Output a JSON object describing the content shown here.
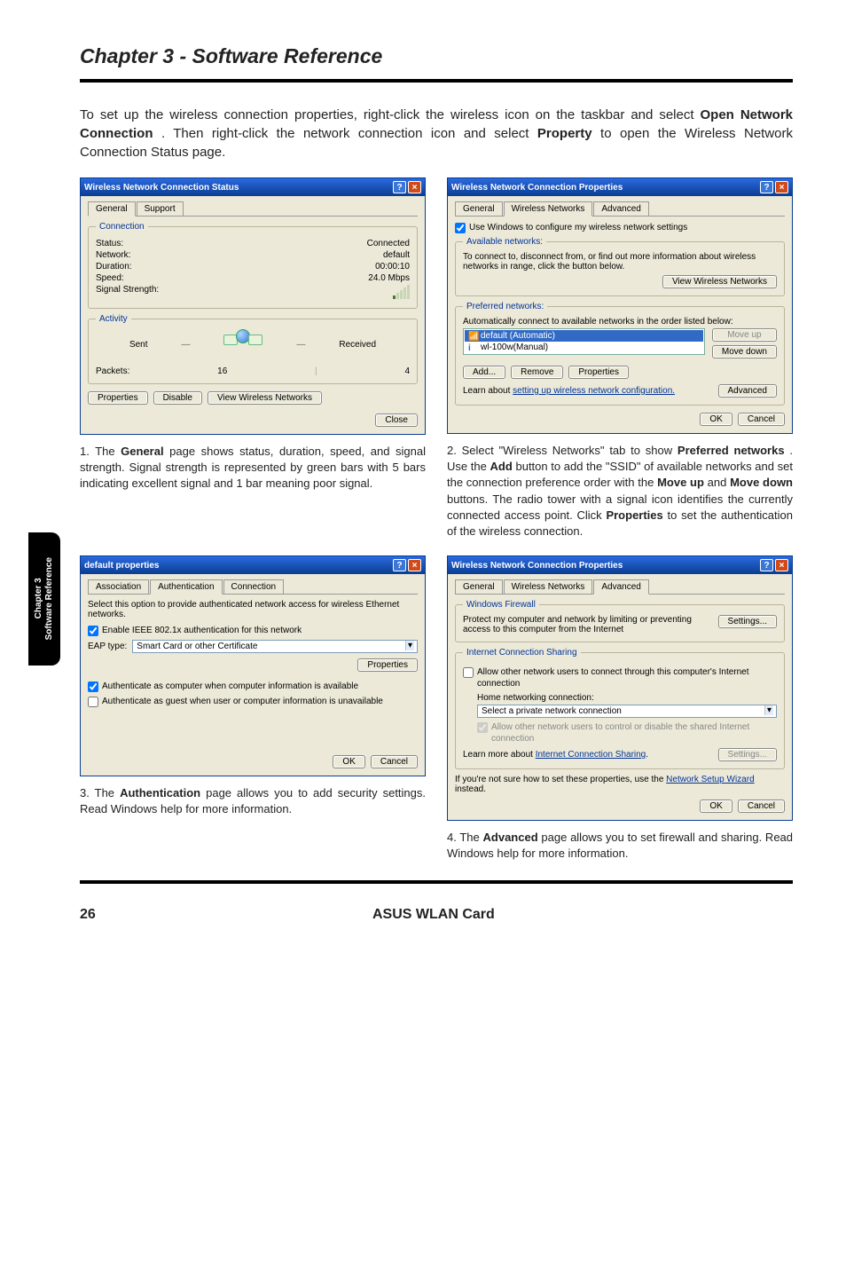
{
  "page": {
    "title": "Chapter 3 - Software Reference",
    "intro_before": "To set up the wireless connection properties, right-click the wireless icon on the taskbar and select ",
    "intro_bold1": "Open Network Connection",
    "intro_mid": ". Then right-click the network connection icon and select ",
    "intro_bold2": "Property",
    "intro_after": " to open the Wireless Network Connection Status page.",
    "side_line1": "Chapter 3",
    "side_line2": "Software Reference",
    "footer_page": "26",
    "footer_product": "ASUS WLAN Card"
  },
  "dlg1": {
    "title": "Wireless Network Connection Status",
    "tabs": [
      "General",
      "Support"
    ],
    "conn_legend": "Connection",
    "status_l": "Status:",
    "status_v": "Connected",
    "network_l": "Network:",
    "network_v": "default",
    "duration_l": "Duration:",
    "duration_v": "00:00:10",
    "speed_l": "Speed:",
    "speed_v": "24.0 Mbps",
    "signal_l": "Signal Strength:",
    "act_legend": "Activity",
    "sent": "Sent",
    "received": "Received",
    "packets_l": "Packets:",
    "packets_sent": "16",
    "packets_recv": "4",
    "btn_properties": "Properties",
    "btn_disable": "Disable",
    "btn_view": "View Wireless Networks",
    "btn_close": "Close"
  },
  "dlg2": {
    "title": "Wireless Network Connection Properties",
    "tabs": [
      "General",
      "Wireless Networks",
      "Advanced"
    ],
    "use_windows": "Use Windows to configure my wireless network settings",
    "avail_legend": "Available networks:",
    "avail_text": "To connect to, disconnect from, or find out more information about wireless networks in range, click the button below.",
    "btn_view": "View Wireless Networks",
    "pref_legend": "Preferred networks:",
    "pref_text": "Automatically connect to available networks in the order listed below:",
    "item1": "default (Automatic)",
    "item2": "wl-100w(Manual)",
    "btn_moveup": "Move up",
    "btn_movedown": "Move down",
    "btn_add": "Add...",
    "btn_remove": "Remove",
    "btn_props": "Properties",
    "learn": "Learn about ",
    "learn_link": "setting up wireless network configuration.",
    "btn_adv": "Advanced",
    "btn_ok": "OK",
    "btn_cancel": "Cancel"
  },
  "dlg3": {
    "title": "default properties",
    "tabs": [
      "Association",
      "Authentication",
      "Connection"
    ],
    "desc": "Select this option to provide authenticated network access for wireless Ethernet networks.",
    "enable_8021x": "Enable IEEE 802.1x authentication for this network",
    "eap_l": "EAP type:",
    "eap_v": "Smart Card or other Certificate",
    "btn_props": "Properties",
    "auth_comp": "Authenticate as computer when computer information is available",
    "auth_guest": "Authenticate as guest when user or computer information is unavailable",
    "btn_ok": "OK",
    "btn_cancel": "Cancel"
  },
  "dlg4": {
    "title": "Wireless Network Connection Properties",
    "tabs": [
      "General",
      "Wireless Networks",
      "Advanced"
    ],
    "fw_legend": "Windows Firewall",
    "fw_text": "Protect my computer and network by limiting or preventing access to this computer from the Internet",
    "btn_settings": "Settings...",
    "ics_legend": "Internet Connection Sharing",
    "ics_allow": "Allow other network users to connect through this computer's Internet connection",
    "ics_home_l": "Home networking connection:",
    "ics_home_v": "Select a private network connection",
    "ics_ctrl": "Allow other network users to control or disable the shared Internet connection",
    "ics_learn_a": "Learn more about ",
    "ics_learn_link": "Internet Connection Sharing",
    "ics_learn_b": ".",
    "btn_settings2": "Settings...",
    "wiz_a": "If you're not sure how to set these properties, use the ",
    "wiz_link": "Network Setup Wizard",
    "wiz_b": " instead.",
    "btn_ok": "OK",
    "btn_cancel": "Cancel"
  },
  "captions": {
    "c1_n": "1. ",
    "c1_a": "The ",
    "c1_b": "General",
    "c1_c": " page shows status, duration, speed, and signal strength. Signal strength is represented by green bars with 5 bars indicating excellent signal and 1 bar meaning poor signal.",
    "c2_n": "2. ",
    "c2_a": "Select \"Wireless Networks\" tab to show ",
    "c2_b": "Preferred networks",
    "c2_c": ". Use the ",
    "c2_d": "Add",
    "c2_e": " button to add the \"SSID\" of available networks and set the connection preference order with the ",
    "c2_f": "Move up",
    "c2_g": " and ",
    "c2_h": "Move down",
    "c2_i": " buttons. The radio tower with a signal icon identifies the currently connected access point. Click ",
    "c2_j": "Properties",
    "c2_k": " to set the authentication of the wireless connection.",
    "c3_n": "3. ",
    "c3_a": "The ",
    "c3_b": "Authentication",
    "c3_c": " page allows you to add security settings. Read Windows help for more information.",
    "c4_n": "4. ",
    "c4_a": "The ",
    "c4_b": "Advanced",
    "c4_c": " page allows you to set firewall and sharing. Read Windows help for more information."
  }
}
